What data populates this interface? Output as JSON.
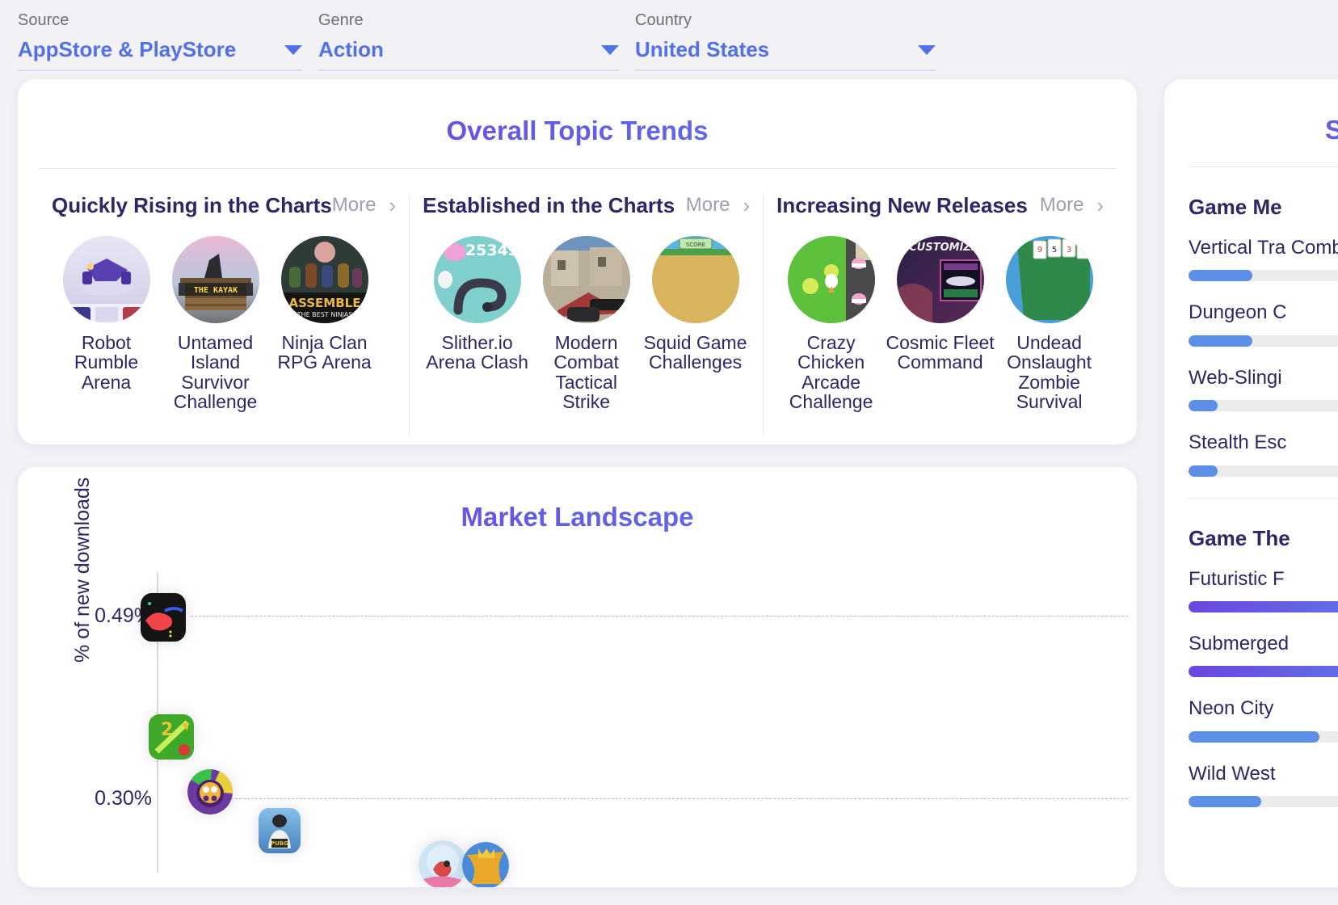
{
  "filters": [
    {
      "label": "Source",
      "value": "AppStore & PlayStore",
      "icon": "chevron-down-icon"
    },
    {
      "label": "Genre",
      "value": "Action",
      "icon": "chevron-down-icon"
    },
    {
      "label": "Country",
      "value": "United States",
      "icon": "chevron-down-icon"
    }
  ],
  "trends": {
    "title": "Overall Topic Trends",
    "columns": [
      {
        "title": "Quickly Rising in the Charts",
        "more_label": "More",
        "apps": [
          {
            "name": "Robot Rumble Arena"
          },
          {
            "name": "Untamed Island Survivor Challenge"
          },
          {
            "name": "Ninja Clan RPG Arena"
          }
        ]
      },
      {
        "title": "Established in the Charts",
        "more_label": "More",
        "apps": [
          {
            "name": "Slither.io Arena Clash"
          },
          {
            "name": "Modern Combat Tactical Strike"
          },
          {
            "name": "Squid Game Challenges"
          }
        ]
      },
      {
        "title": "Increasing New Releases",
        "more_label": "More",
        "apps": [
          {
            "name": "Crazy Chicken Arcade Challenge"
          },
          {
            "name": "Cosmic Fleet Command"
          },
          {
            "name": "Undead Onslaught Zombie Survival"
          }
        ]
      }
    ]
  },
  "market": {
    "title": "Market Landscape"
  },
  "chart_data": {
    "type": "scatter",
    "title": "Market Landscape",
    "xlabel": "",
    "ylabel": "% of new downloads",
    "ytick_labels": [
      "0.49%",
      "0.30%"
    ],
    "yticks": [
      0.49,
      0.3
    ],
    "grid": true,
    "points": [
      {
        "label": "app-1",
        "x": 0.0,
        "y": 0.49
      },
      {
        "label": "app-2",
        "x": 0.01,
        "y": 0.38
      },
      {
        "label": "app-3",
        "x": 0.04,
        "y": 0.31
      },
      {
        "label": "app-4",
        "x": 0.12,
        "y": 0.275
      },
      {
        "label": "app-5",
        "x": 0.3,
        "y": 0.24
      },
      {
        "label": "app-6",
        "x": 0.35,
        "y": 0.24
      }
    ]
  },
  "side_panel": {
    "title": "S",
    "sections": [
      {
        "title": "Game Me",
        "items": [
          {
            "label": "Vertical Tra Combat",
            "value": 22,
            "style": "blue"
          },
          {
            "label": "Dungeon C",
            "value": 22,
            "style": "blue"
          },
          {
            "label": "Web-Slingi",
            "value": 10,
            "style": "blue"
          },
          {
            "label": "Stealth Esc",
            "value": 10,
            "style": "blue"
          }
        ]
      },
      {
        "title": "Game The",
        "items": [
          {
            "label": "Futuristic F",
            "value": 100,
            "style": "grad"
          },
          {
            "label": "Submerged",
            "value": 100,
            "style": "grad"
          },
          {
            "label": "Neon City",
            "value": 45,
            "style": "blue"
          },
          {
            "label": "Wild West",
            "value": 25,
            "style": "blue"
          }
        ]
      }
    ]
  }
}
